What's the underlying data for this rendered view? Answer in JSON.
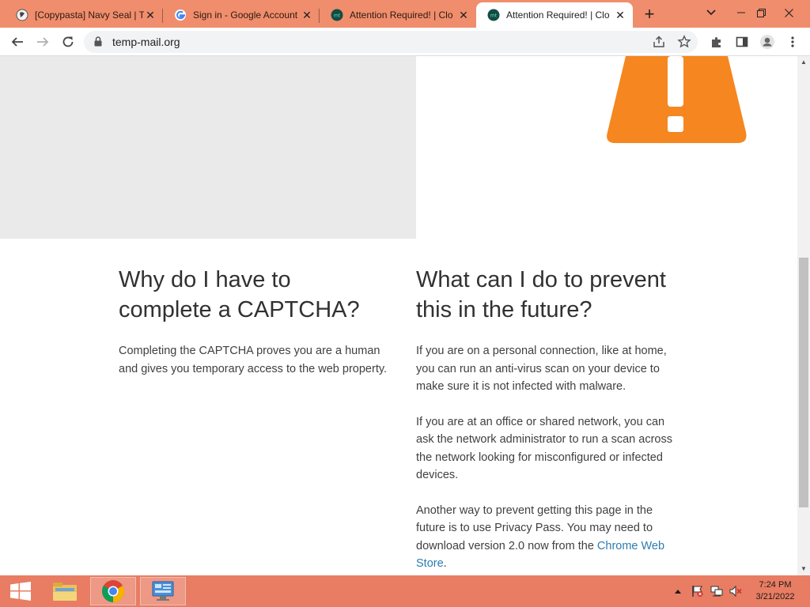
{
  "browser": {
    "tabs": [
      {
        "title": "[Copypasta] Navy Seal | T",
        "favicon": "knowyourmeme-icon"
      },
      {
        "title": "Sign in - Google Account",
        "favicon": "google-icon"
      },
      {
        "title": "Attention Required! | Clo",
        "favicon": "cloudflare-icon"
      },
      {
        "title": "Attention Required! | Clo",
        "favicon": "cloudflare-icon",
        "active": true
      }
    ],
    "new_tab_label": "+",
    "url": "temp-mail.org"
  },
  "page": {
    "left_column": {
      "heading": "Why do I have to complete a CAPTCHA?",
      "paragraph": "Completing the CAPTCHA proves you are a human and gives you temporary access to the web property."
    },
    "right_column": {
      "heading": "What can I do to prevent this in the future?",
      "paragraph_1": "If you are on a personal connection, like at home, you can run an anti-virus scan on your device to make sure it is not infected with malware.",
      "paragraph_2": "If you are at an office or shared network, you can ask the network administrator to run a scan across the network looking for misconfigured or infected devices.",
      "paragraph_3_prefix": "Another way to prevent getting this page in the future is to use Privacy Pass. You may need to download version 2.0 now from the ",
      "paragraph_3_link": "Chrome Web Store",
      "paragraph_3_suffix": "."
    },
    "warning_color": "#f6861f"
  },
  "taskbar": {
    "time": "7:24 PM",
    "date": "3/21/2022",
    "items": [
      "start-icon",
      "file-explorer-icon",
      "chrome-icon",
      "control-panel-icon"
    ]
  }
}
